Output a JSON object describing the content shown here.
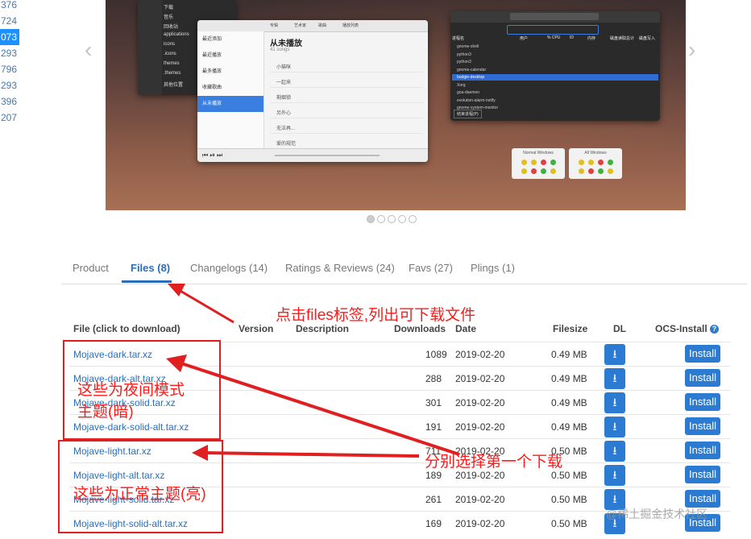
{
  "gutter": [
    "376",
    "724",
    "073",
    "293",
    "796",
    "293",
    "396",
    "207"
  ],
  "gutter_selected_index": 2,
  "carousel": {
    "file_manager_items": [
      "applications",
      "icons",
      ".icons",
      "themes",
      ".themes",
      "其他位置"
    ],
    "file_manager_side": [
      "下载",
      "音乐",
      "回收站",
      "applications",
      "icons",
      ".icons",
      "themes",
      ".themes",
      "其他位置"
    ],
    "music_tabs": [
      "专辑",
      "艺术家",
      "歌曲",
      "播放列表"
    ],
    "music_nav": [
      "最近添加",
      "最近播放",
      "最多播放",
      "收藏歌曲",
      "从未播放"
    ],
    "music_nav_active": 4,
    "music_title": "从未播放",
    "music_subtitle": "41 songs",
    "music_rows": [
      "小猫咪",
      "一起来",
      "剩烟锁",
      "另外心",
      "无法再...",
      "爱的规范"
    ],
    "sysmon_header": [
      "进程名",
      "用户",
      "% CPU",
      "ID",
      "内存",
      "磁盘读取总计",
      "磁盘写入"
    ],
    "sysmon_rows": [
      "gnome-shell",
      "python3",
      "python3",
      "gnome-calendar",
      "budgie-desktop",
      "Xorg",
      "goa-daemon",
      "evolution-alarm-notify",
      "gnome-system-monitor"
    ],
    "sysmon_selected": 4,
    "sysmon_button": "结束进程(P)",
    "widget_left_title": "Normal Windows",
    "widget_right_title": "All Windows",
    "dots_count": 5,
    "dots_active": 0
  },
  "tabs": [
    {
      "label": "Product"
    },
    {
      "label": "Files (8)"
    },
    {
      "label": "Changelogs (14)"
    },
    {
      "label": "Ratings & Reviews (24)"
    },
    {
      "label": "Favs (27)"
    },
    {
      "label": "Plings (1)"
    }
  ],
  "active_tab": 1,
  "table": {
    "headers": {
      "file": "File (click to download)",
      "version": "Version",
      "description": "Description",
      "downloads": "Downloads",
      "date": "Date",
      "filesize": "Filesize",
      "dl": "DL",
      "ocs": "OCS-Install"
    },
    "help_icon": "question-icon",
    "rows": [
      {
        "file": "Mojave-dark.tar.xz",
        "downloads": "1089",
        "date": "2019-02-20",
        "size": "0.49 MB",
        "install": "Install"
      },
      {
        "file": "Mojave-dark-alt.tar.xz",
        "downloads": "288",
        "date": "2019-02-20",
        "size": "0.49 MB",
        "install": "Install"
      },
      {
        "file": "Mojave-dark-solid.tar.xz",
        "downloads": "301",
        "date": "2019-02-20",
        "size": "0.49 MB",
        "install": "Install"
      },
      {
        "file": "Mojave-dark-solid-alt.tar.xz",
        "downloads": "191",
        "date": "2019-02-20",
        "size": "0.49 MB",
        "install": "Install"
      },
      {
        "file": "Mojave-light.tar.xz",
        "downloads": "711",
        "date": "2019-02-20",
        "size": "0.50 MB",
        "install": "Install"
      },
      {
        "file": "Mojave-light-alt.tar.xz",
        "downloads": "189",
        "date": "2019-02-20",
        "size": "0.50 MB",
        "install": "Install"
      },
      {
        "file": "Mojave-light-solid.tar.xz",
        "downloads": "261",
        "date": "2019-02-20",
        "size": "0.50 MB",
        "install": "Install"
      },
      {
        "file": "Mojave-light-solid-alt.tar.xz",
        "downloads": "169",
        "date": "2019-02-20",
        "size": "0.50 MB",
        "install": "Install"
      }
    ]
  },
  "annotations": {
    "files_tab_note": "点击files标签,列出可下载文件",
    "dark_note_line1": "这些为夜间模式",
    "dark_note_line2": "主题(暗)",
    "light_note": "这些为正常主题(亮)",
    "choose_note": "分别选择第一个下载",
    "color": "#ff1a1a"
  },
  "watermark": "@稀土掘金技术社区",
  "colors": {
    "accent": "#2a7bd1",
    "link": "#2a6ebb",
    "selection": "#1e90ff"
  }
}
